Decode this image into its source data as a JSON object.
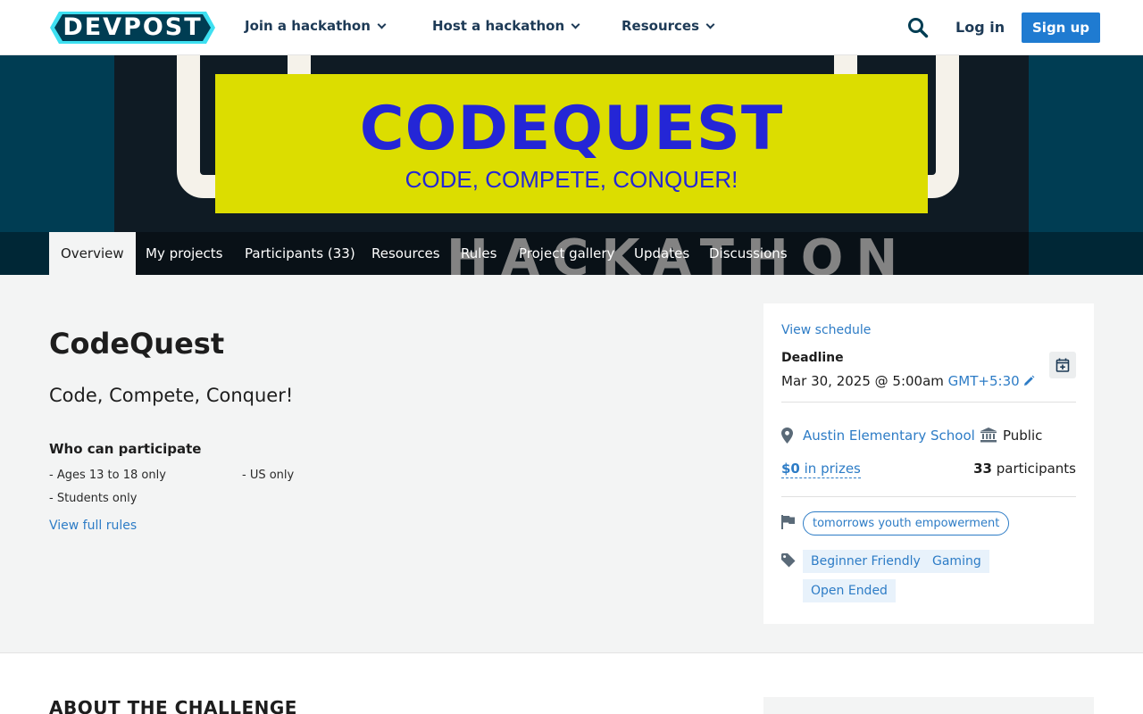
{
  "header": {
    "logo_text": "DEVPOST",
    "nav": [
      {
        "label": "Join a hackathon"
      },
      {
        "label": "Host a hackathon"
      },
      {
        "label": "Resources"
      }
    ],
    "login_label": "Log in",
    "signup_label": "Sign up"
  },
  "banner": {
    "poster_title": "CODEQUEST",
    "poster_subtitle": "CODE, COMPETE, CONQUER!",
    "background_word": "HACKATHON"
  },
  "tabs": [
    {
      "label": "Overview",
      "active": true
    },
    {
      "label": "My projects"
    },
    {
      "label": "Participants (33)"
    },
    {
      "label": "Resources"
    },
    {
      "label": "Rules"
    },
    {
      "label": "Project gallery"
    },
    {
      "label": "Updates"
    },
    {
      "label": "Discussions"
    }
  ],
  "main": {
    "title": "CodeQuest",
    "tagline": "Code, Compete, Conquer!",
    "who_heading": "Who can participate",
    "criteria": [
      "Ages 13 to 18 only",
      "US only",
      "Students only"
    ],
    "rules_link": "View full rules",
    "about_heading": "ABOUT THE CHALLENGE"
  },
  "sidebar": {
    "schedule_link": "View schedule",
    "deadline_label": "Deadline",
    "deadline_date": "Mar 30, 2025 @ 5:00am",
    "timezone": "GMT+5:30",
    "location": "Austin Elementary School",
    "visibility": "Public",
    "prize_amount": "$0",
    "prize_suffix": " in prizes",
    "participant_count": "33",
    "participant_suffix": " participants",
    "host": "tomorrows youth empowerment",
    "themes": [
      "Beginner Friendly",
      "Gaming",
      "Open Ended"
    ]
  },
  "colors": {
    "brand_navy": "#003d53",
    "link_blue": "#2d7cc6",
    "signup_blue": "#1f7bd1",
    "poster_yellow": "#dcdd00",
    "poster_text_blue": "#2426d6"
  },
  "icons": [
    "search-icon",
    "chevron-down-icon",
    "pencil-icon",
    "calendar-add-icon",
    "location-pin-icon",
    "bank-icon",
    "flag-icon",
    "tag-icon"
  ]
}
